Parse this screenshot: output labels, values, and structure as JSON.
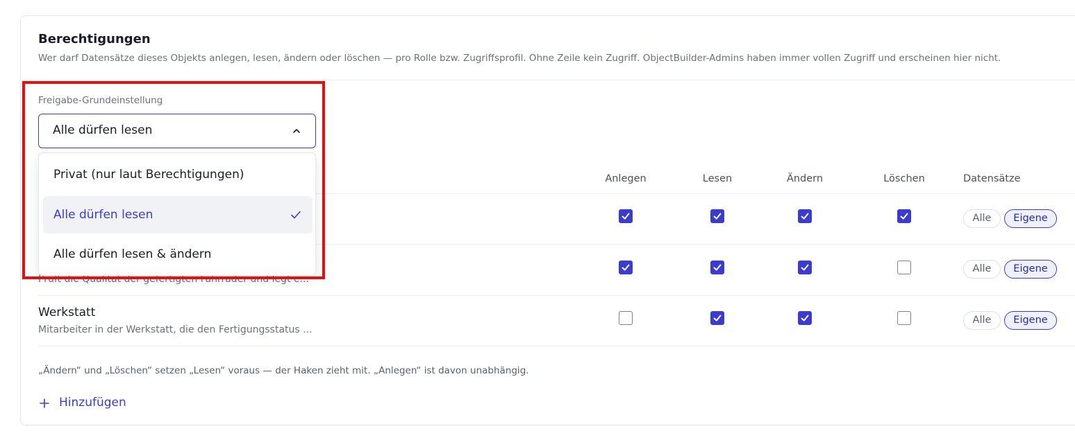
{
  "section": {
    "title": "Berechtigungen",
    "subtitle": "Wer darf Datensätze dieses Objekts anlegen, lesen, ändern oder löschen — pro Rolle bzw. Zugriffsprofil. Ohne Zeile kein Zugriff. ObjectBuilder-Admins haben immer vollen Zugriff und erscheinen hier nicht."
  },
  "sharing": {
    "label": "Freigabe-Grundeinstellung",
    "selected": "Alle dürfen lesen",
    "options": [
      {
        "label": "Privat (nur laut Berechtigungen)",
        "selected": false
      },
      {
        "label": "Alle dürfen lesen",
        "selected": true
      },
      {
        "label": "Alle dürfen lesen & ändern",
        "selected": false
      }
    ]
  },
  "table": {
    "columns": [
      "Anlegen",
      "Lesen",
      "Ändern",
      "Löschen",
      "Datensätze"
    ],
    "rows": [
      {
        "name": "",
        "description": "",
        "anlegen": true,
        "lesen": true,
        "aendern": true,
        "loeschen": true,
        "scope_options": [
          "Alle",
          "Eigene"
        ],
        "scope": "Eigene"
      },
      {
        "name": "",
        "description": "Prüft die Qualität der gefertigten Fahrräder und legt e...",
        "anlegen": true,
        "lesen": true,
        "aendern": true,
        "loeschen": false,
        "scope_options": [
          "Alle",
          "Eigene"
        ],
        "scope": "Eigene"
      },
      {
        "name": "Werkstatt",
        "description": "Mitarbeiter in der Werkstatt, die den Fertigungsstatus ...",
        "anlegen": false,
        "lesen": true,
        "aendern": true,
        "loeschen": false,
        "scope_options": [
          "Alle",
          "Eigene"
        ],
        "scope": "Eigene"
      }
    ]
  },
  "note": "„Ändern“ und „Löschen“ setzen „Lesen“ voraus — der Haken zieht mit. „Anlegen“ ist davon unabhängig.",
  "add_button": {
    "label": "Hinzufügen"
  },
  "colors": {
    "accent": "#3b3bd0",
    "highlight": "#e41010"
  }
}
